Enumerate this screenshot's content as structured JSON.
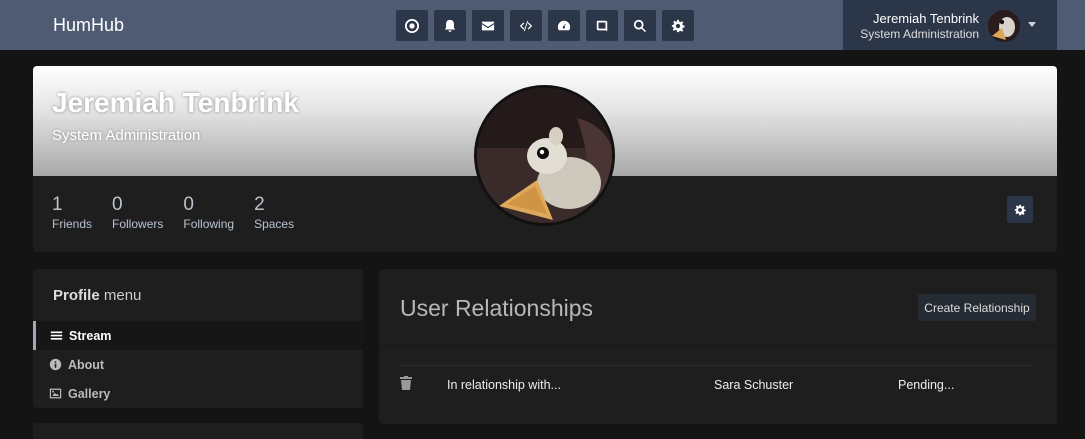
{
  "topbar": {
    "brand": "HumHub",
    "nav_icons": [
      "dashboard-icon",
      "bell-icon",
      "envelope-icon",
      "code-icon",
      "tachometer-icon",
      "book-icon",
      "search-icon",
      "settings-icon"
    ],
    "user": {
      "name": "Jeremiah Tenbrink",
      "role": "System Administration"
    }
  },
  "profile": {
    "name": "Jeremiah Tenbrink",
    "title": "System Administration",
    "stats": [
      {
        "value": "1",
        "label": "Friends"
      },
      {
        "value": "0",
        "label": "Followers"
      },
      {
        "value": "0",
        "label": "Following"
      },
      {
        "value": "2",
        "label": "Spaces"
      }
    ]
  },
  "sidebar": {
    "heading_bold": "Profile",
    "heading_rest": " menu",
    "items": [
      {
        "label": "Stream",
        "icon": "bars-icon"
      },
      {
        "label": "About",
        "icon": "info-icon"
      },
      {
        "label": "Gallery",
        "icon": "image-icon"
      }
    ]
  },
  "main": {
    "title": "User Relationships",
    "create_label": "Create Relationship",
    "rows": [
      {
        "type": "In relationship with...",
        "person": "Sara Schuster",
        "status": "Pending..."
      }
    ]
  }
}
